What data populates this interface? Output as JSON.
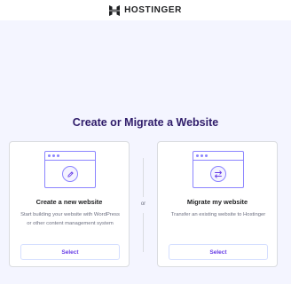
{
  "header": {
    "brand": "HOSTINGER"
  },
  "main": {
    "title": "Create or Migrate a Website",
    "separator": "or",
    "options": [
      {
        "title": "Create a new website",
        "description": "Start building your website with WordPress or other content management system",
        "action_label": "Select",
        "icon": "pencil-icon"
      },
      {
        "title": "Migrate my website",
        "description": "Transfer an existing website to Hostinger",
        "action_label": "Select",
        "icon": "swap-arrows-icon"
      }
    ]
  },
  "colors": {
    "background": "#f4f5ff",
    "accent": "#673de6",
    "title": "#2f1c6a",
    "illustration": "#8c85ff"
  }
}
